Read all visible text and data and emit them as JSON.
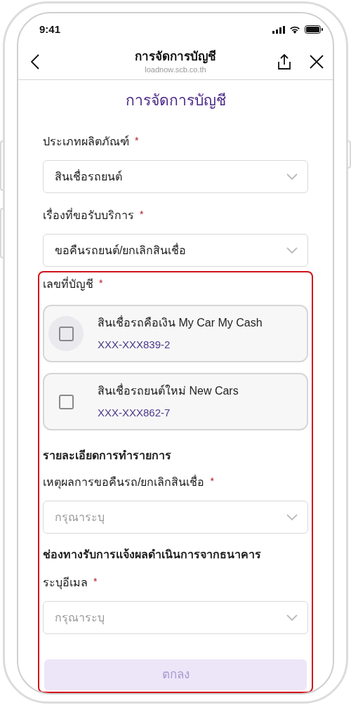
{
  "status_bar": {
    "time": "9:41"
  },
  "header": {
    "title": "การจัดการบัญชี",
    "url": "loadnow.scb.co.th"
  },
  "page_title": "การจัดการบัญชี",
  "fields": [
    {
      "label": "ประเภทผลิตภัณฑ์",
      "required_mark": "*",
      "value": "สินเชื่อรถยนต์"
    },
    {
      "label": "เรื่องที่ขอรับบริการ",
      "required_mark": "*",
      "value": "ขอคืนรถยนต์/ยกเลิกสินเชื่อ"
    }
  ],
  "account_section": {
    "label": "เลขที่บัญชี",
    "required_mark": "*",
    "highlighted": true,
    "accounts": [
      {
        "name": "สินเชื่อรถคือเงิน My Car My Cash",
        "number": "XXX-XXX839-2",
        "checked": false,
        "focused": true
      },
      {
        "name": "สินเชื่อรถยนต์ใหม่ New Cars",
        "number": "XXX-XXX862-7",
        "checked": false,
        "focused": false
      }
    ],
    "details_heading": "รายละเอียดการทำรายการ",
    "reason_field": {
      "label": "เหตุผลการขอคืนรถ/ยกเลิกสินเชื่อ",
      "required_mark": "*",
      "placeholder": "กรุณาระบุ"
    },
    "channel_heading": "ช่องทางรับการแจ้งผลดำเนินการจากธนาคาร",
    "email_field": {
      "label": "ระบุอีเมล",
      "required_mark": "*",
      "placeholder": "กรุณาระบุ"
    },
    "submit_button": {
      "label": "ตกลง",
      "disabled": true
    }
  }
}
